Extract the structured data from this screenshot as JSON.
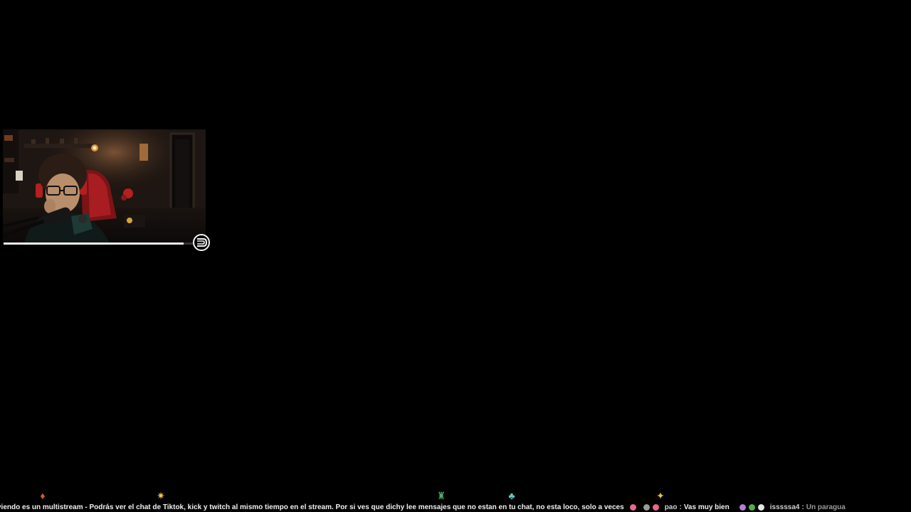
{
  "webcam": {
    "type": "webcam-overlay",
    "progress": 0.93
  },
  "ticker": {
    "announcement": "viendo es un multistream - Podrás ver el chat de Tiktok, kick y twitch al mismo tiempo en el stream. Por si ves que dichy lee mensajes que no estan en tu chat, no esta loco, solo a veces",
    "messages": [
      {
        "user": "pao",
        "separator": ":",
        "text": "Vas muy bien"
      },
      {
        "user": "isssssa4",
        "separator": ":",
        "text": "Un paragua"
      }
    ],
    "icons": [
      {
        "name": "sprite-small-icon",
        "glyph": "♦",
        "color": "#c9602a"
      },
      {
        "name": "fairy-sprite-icon",
        "glyph": "✷",
        "color": "#f1c24b"
      },
      {
        "name": "robot-sprite-icon",
        "glyph": "♜",
        "color": "#5aa46a"
      },
      {
        "name": "creature-sprite-icon",
        "glyph": "♣",
        "color": "#6cc6c0"
      },
      {
        "name": "star-sprite-icon",
        "glyph": "✦",
        "color": "#e3c23a"
      }
    ],
    "badge_colors": {
      "pink": "#e9668f",
      "grey": "#9a9a9a",
      "purple": "#b57bd6",
      "green": "#4cb04a",
      "white": "#e6e6e6"
    }
  }
}
